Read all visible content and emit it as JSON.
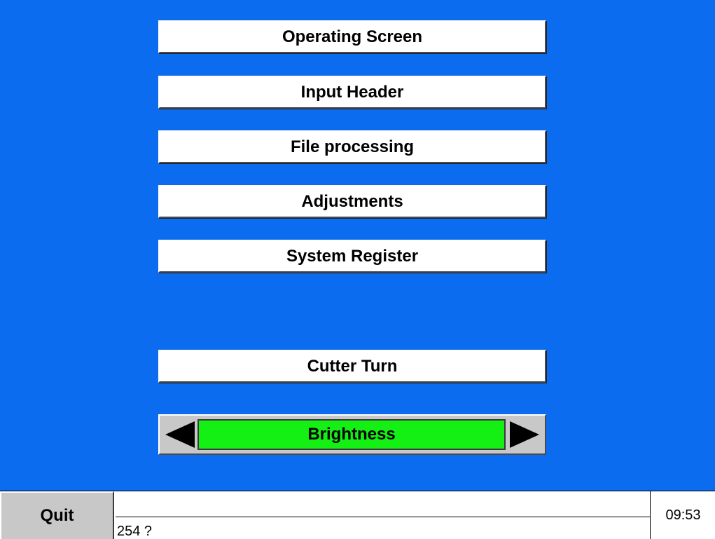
{
  "menu": {
    "operating_screen": "Operating Screen",
    "input_header": "Input Header",
    "file_processing": "File processing",
    "adjustments": "Adjustments",
    "system_register": "System Register",
    "cutter_turn": "Cutter Turn"
  },
  "brightness": {
    "label": "Brightness",
    "left_icon": "triangle-left-icon",
    "right_icon": "triangle-right-icon",
    "bar_color": "#14f014"
  },
  "statusbar": {
    "quit_label": "Quit",
    "message_line_1": "",
    "message_line_2": "254 ?",
    "time": "09:53"
  },
  "colors": {
    "background": "#0b6cf0",
    "button_face": "#ffffff",
    "panel_gray": "#c8c8c8"
  }
}
